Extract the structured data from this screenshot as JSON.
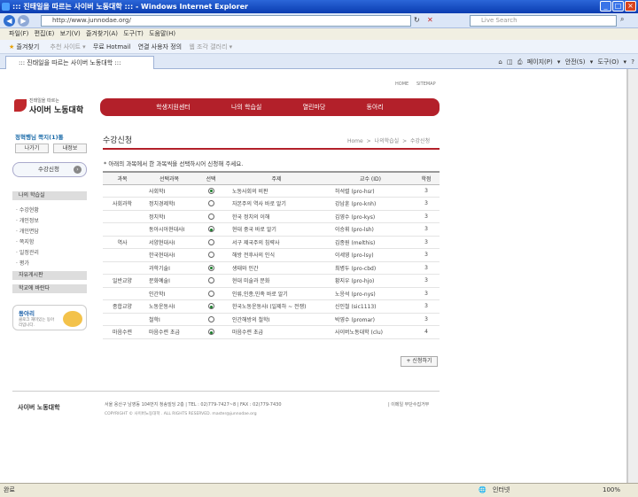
{
  "window": {
    "title": "::: 진태일을 따르는 사이버 노동대학 ::: - Windows Internet Explorer",
    "url": "http://www.junnodae.org/",
    "search_placeholder": "Live Search"
  },
  "menu": [
    "파일(F)",
    "편집(E)",
    "보기(V)",
    "즐겨찾기(A)",
    "도구(T)",
    "도움말(H)"
  ],
  "favbar": {
    "favorites": "즐겨찾기",
    "items": [
      "추천 사이트 ▾",
      "무료 Hotmail",
      "연결 사용자 정의",
      "웹 조각 갤러리 ▾"
    ]
  },
  "tab": {
    "label": "::: 진태일을 따르는 사이버 노동대학 :::"
  },
  "tools": [
    "페이지(P) ▾",
    "안전(S) ▾",
    "도구(O) ▾"
  ],
  "status": {
    "left": "완료",
    "zone": "인터넷",
    "zoom": "100%"
  },
  "page": {
    "top_links": [
      "HOME",
      "SITEMAP"
    ],
    "logo_small": "진태일을 따르는",
    "logo_big": "사이버 노동대학",
    "gnb": [
      "학생지원센터",
      "나의 학습실",
      "열린마당",
      "동아리"
    ],
    "user": "정혁행님 쪽지(1)통",
    "btn_logout": "나가기",
    "btn_info": "내정보",
    "apply_label": "수강신청",
    "lm_head1": "나의 학습실",
    "lm_items": [
      "· 수강현황",
      "· 개인정보",
      "· 개인면담",
      "· 쪽지함",
      "· 일정관리",
      "· 평가"
    ],
    "lm_head2": "자유게시판",
    "lm_head3": "학교에 바란다",
    "banner_title": "동아리",
    "banner_sub": "클로크 재미있는 동아리입니다.",
    "heading": "수강신청",
    "crumb": "Home > 나의학습실 > 수강신청",
    "notice": "* 아래의 과목에서 한 과목씩을 선택하시어 신청해 주세요.",
    "table": {
      "headers": [
        "과목",
        "선택과목",
        "선택",
        "주제",
        "교수 (ID)",
        "학점"
      ],
      "rows": [
        {
          "group": "",
          "course": "사회학I",
          "on": true,
          "topic": "노동사회의 비판",
          "prof": "허석렬 (pro-hsr)",
          "credit": "3"
        },
        {
          "group": "사회과학",
          "course": "정치경제학I",
          "on": false,
          "topic": "자본주의 역사 바로 알기",
          "prof": "강남훈 (pro-knh)",
          "credit": "3"
        },
        {
          "group": "",
          "course": "정치학I",
          "on": false,
          "topic": "한국 정치의 이해",
          "prof": "김영수 (pro-kys)",
          "credit": "3"
        },
        {
          "group": "",
          "course": "동아시아현대사I",
          "on": true,
          "topic": "현대 중국 바로 알기",
          "prof": "이승휘 (pro-lsh)",
          "credit": "3"
        },
        {
          "group": "역사",
          "course": "서양현대사I",
          "on": false,
          "topic": "서구 제국주의 침략사",
          "prof": "김종원 (melthis)",
          "credit": "3"
        },
        {
          "group": "",
          "course": "한국현대사I",
          "on": false,
          "topic": "해방 전후사의 인식",
          "prof": "이세영 (pro-lsy)",
          "credit": "3"
        },
        {
          "group": "",
          "course": "과학기술I",
          "on": true,
          "topic": "생태와 인간",
          "prof": "최병두 (pro-cbd)",
          "credit": "3"
        },
        {
          "group": "일반교양",
          "course": "문화예술I",
          "on": false,
          "topic": "현대 미술과 문화",
          "prof": "황지우 (pro-hjo)",
          "credit": "3"
        },
        {
          "group": "",
          "course": "인간학I",
          "on": false,
          "topic": "인류,인종,민족 바로 알기",
          "prof": "노응석 (pro-nys)",
          "credit": "3"
        },
        {
          "group": "종합교양",
          "course": "노동운동사I",
          "on": true,
          "topic": "한국노동운동사I (일제하 ~ 전쟁)",
          "prof": "신인철 (sic1113)",
          "credit": "3"
        },
        {
          "group": "",
          "course": "철학I",
          "on": false,
          "topic": "인간해방의 철학I",
          "prof": "박영수 (promar)",
          "credit": "3"
        },
        {
          "group": "마음수련",
          "course": "마음수련 초급",
          "on": true,
          "topic": "마음수련 초급",
          "prof": "사이버노동대학 (clu)",
          "credit": "4"
        }
      ]
    },
    "submit": "+ 신청하기",
    "footer": {
      "logo": "사이버 노동대학",
      "addr": "서울 용산구 남영동 104번지 청송빌딩 2층  |  TEL : 02)779-7427~8  |  FAX : 02)779-7430",
      "copy": "COPYRIGHT © 사이버노동대학 . ALL RIGHTS RESERVED.   master@junnodae.org",
      "right": "| 이메일 무단수집거부"
    }
  }
}
